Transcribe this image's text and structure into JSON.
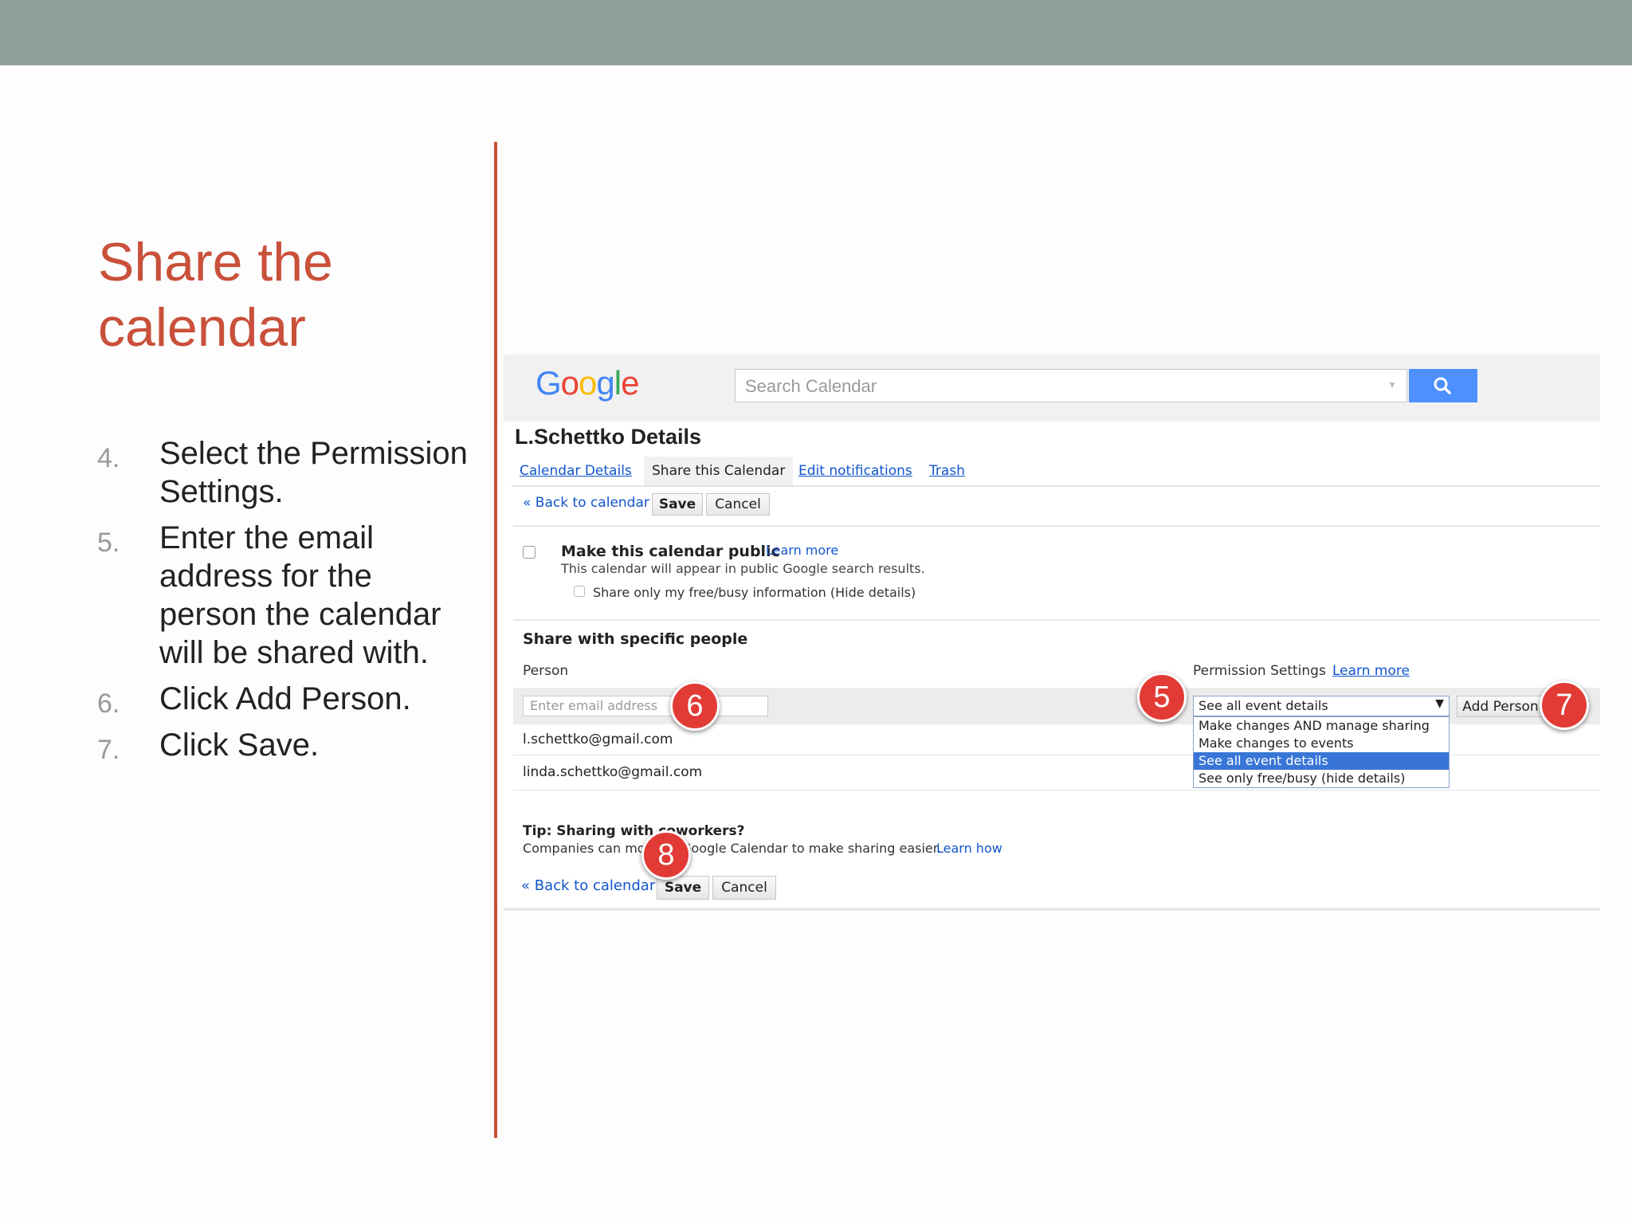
{
  "slide": {
    "title_line1": "Share the",
    "title_line2": "calendar",
    "steps": [
      {
        "num": "4.",
        "text": "Select the Permission Settings."
      },
      {
        "num": "5.",
        "text": "Enter the email address for the person the calendar will be shared with."
      },
      {
        "num": "6.",
        "text": "Click Add Person."
      },
      {
        "num": "7.",
        "text": "Click Save."
      }
    ]
  },
  "colors": {
    "accent": "#c9503a",
    "topbar": "#909f97",
    "link": "#1155cc",
    "badge": "#e23b36"
  },
  "header": {
    "logo": [
      "G",
      "o",
      "o",
      "g",
      "l",
      "e"
    ],
    "logo_colors": [
      "#4285f4",
      "#ea4335",
      "#fbbc05",
      "#4285f4",
      "#34a853",
      "#ea4335"
    ],
    "search_placeholder": "Search Calendar"
  },
  "page": {
    "heading": "L.Schettko Details",
    "tabs": [
      "Calendar Details",
      "Share this Calendar",
      "Edit notifications",
      "Trash"
    ],
    "back_link": "« Back to calendar",
    "save": "Save",
    "cancel": "Cancel"
  },
  "public": {
    "label": "Make this calendar public",
    "learn_more": "Learn more",
    "desc": "This calendar will appear in public Google search results.",
    "freebusy": "Share only my free/busy information (Hide details)"
  },
  "share": {
    "heading": "Share with specific people",
    "person_col": "Person",
    "permission_col": "Permission Settings",
    "permission_learn": "Learn more",
    "email_placeholder": "Enter email address",
    "selected_permission": "See all event details",
    "options": [
      "Make changes AND manage sharing",
      "Make changes to events",
      "See all event details",
      "See only free/busy (hide details)"
    ],
    "add_person": "Add Person",
    "people": [
      "l.schettko@gmail.com",
      "linda.schettko@gmail.com"
    ]
  },
  "tip": {
    "heading": "Tip: Sharing with coworkers?",
    "text": "Companies can move to Google Calendar to make sharing easier.",
    "learn_how": "Learn how"
  },
  "badges": [
    "5",
    "6",
    "7",
    "8"
  ]
}
